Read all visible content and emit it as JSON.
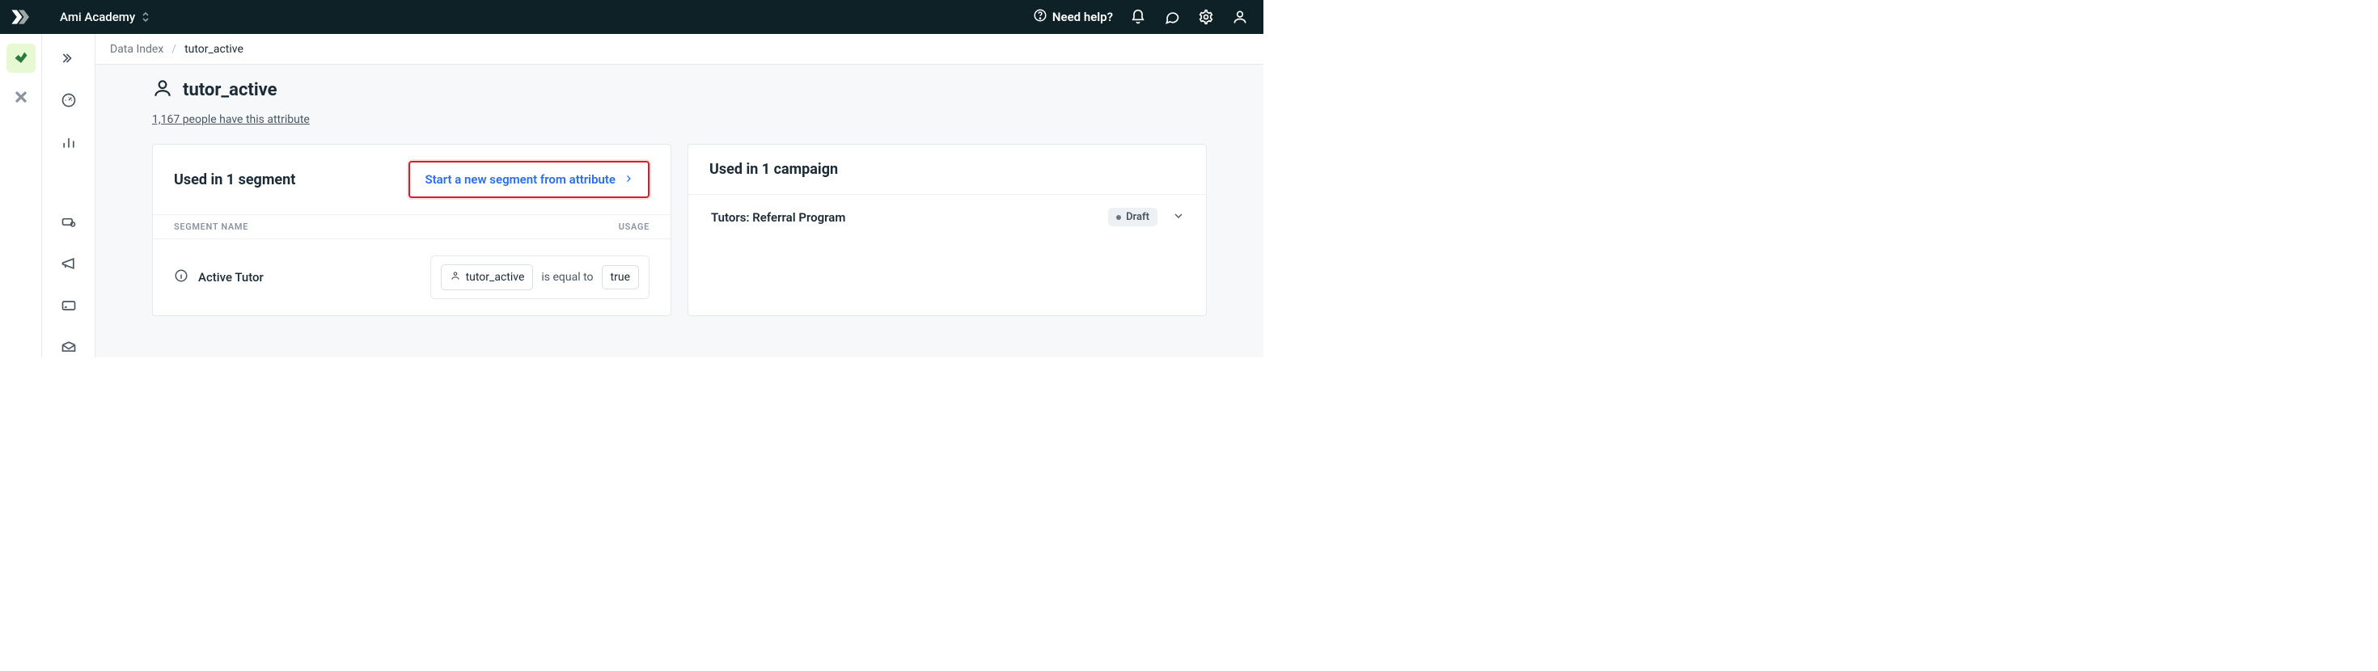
{
  "header": {
    "workspace": "Ami Academy",
    "need_help": "Need help?"
  },
  "breadcrumb": {
    "root": "Data Index",
    "current": "tutor_active"
  },
  "page": {
    "title": "tutor_active",
    "count_link": "1,167 people have this attribute"
  },
  "segments_card": {
    "title": "Used in 1 segment",
    "new_button": "Start a new segment from attribute",
    "col_name": "SEGMENT NAME",
    "col_usage": "USAGE",
    "rows": [
      {
        "name": "Active Tutor",
        "condition": {
          "attr": "tutor_active",
          "operator": "is equal to",
          "value": "true"
        }
      }
    ]
  },
  "campaigns_card": {
    "title": "Used in 1 campaign",
    "rows": [
      {
        "name": "Tutors: Referral Program",
        "status": "Draft"
      }
    ]
  }
}
